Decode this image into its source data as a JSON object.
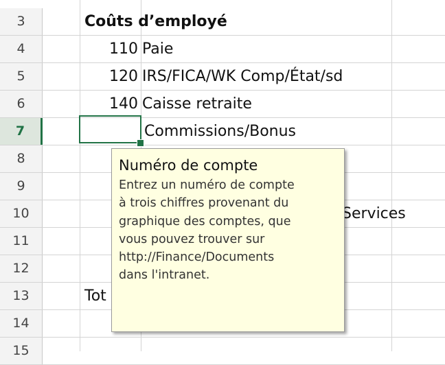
{
  "rows": [
    {
      "num": "3",
      "b": "",
      "c": ""
    },
    {
      "num": "4",
      "b": "110",
      "c": "Paie"
    },
    {
      "num": "5",
      "b": "120",
      "c": "IRS/FICA/WK Comp/État/sd"
    },
    {
      "num": "6",
      "b": "140",
      "c": "Caisse retraite"
    },
    {
      "num": "7",
      "b": "",
      "c": "Commissions/Bonus"
    },
    {
      "num": "8",
      "b": "",
      "c": ""
    },
    {
      "num": "9",
      "b": "",
      "c": ""
    },
    {
      "num": "10",
      "b": "",
      "c": ""
    },
    {
      "num": "11",
      "b": "",
      "c": ""
    },
    {
      "num": "12",
      "b": "",
      "c": ""
    },
    {
      "num": "13",
      "b": "",
      "c": ""
    },
    {
      "num": "14",
      "b": "",
      "c": ""
    },
    {
      "num": "15",
      "b": "",
      "c": ""
    }
  ],
  "section_heading": "Coûts d’employé",
  "active_row": "7",
  "partial": {
    "row10_c": "Services",
    "row13_a": "Tot"
  },
  "tooltip": {
    "title": "Numéro de compte",
    "lines": [
      "Entrez un numéro de compte",
      "à trois chiffres provenant du",
      "graphique des comptes, que",
      "vous pouvez trouver sur",
      "http://Finance/Documents",
      "dans l'intranet."
    ]
  },
  "colors": {
    "selection": "#217346",
    "tooltip_bg": "#ffffe1"
  }
}
